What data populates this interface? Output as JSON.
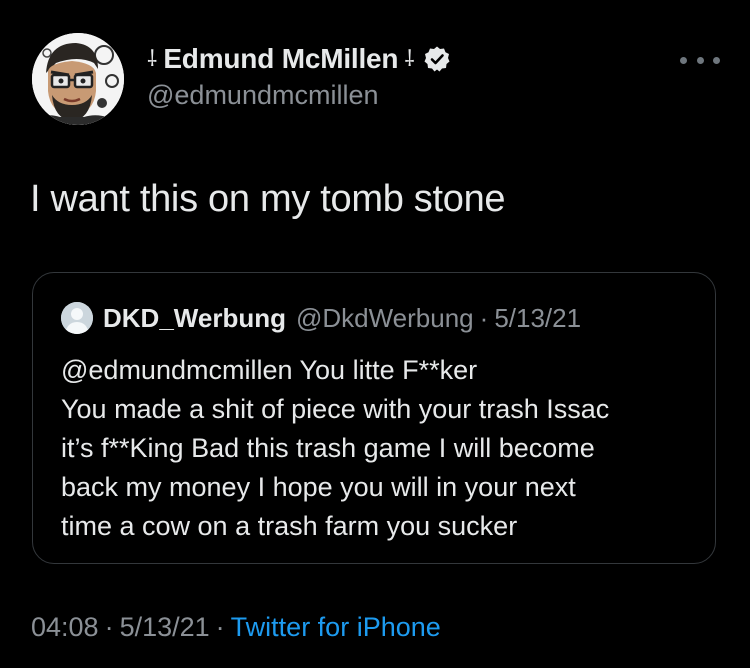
{
  "author": {
    "display_name": "Edmund McMillen",
    "handle": "@edmundmcmillen",
    "name_prefix_glyph": "⸸",
    "name_suffix_glyph": "⸸",
    "avatar_icon": "cartoon-portrait-avatar",
    "verified_icon": "verified-badge-icon"
  },
  "tweet": {
    "text": "I want this on my tomb stone"
  },
  "quoted_tweet": {
    "display_name": "DKD_Werbung",
    "handle": "@DkdWerbung",
    "separator": "·",
    "date": "5/13/21",
    "lines": [
      "@edmundmcmillen You litte F**ker",
      "You made a shit of piece with your trash Issac",
      "it’s f**King Bad this trash game I will become",
      "back my money I hope you will in your next",
      "time a cow on a trash farm you sucker"
    ]
  },
  "meta": {
    "time": "04:08",
    "separator": "·",
    "date": "5/13/21",
    "source": "Twitter for iPhone"
  },
  "colors": {
    "background": "#000000",
    "primary_text": "#e7e9ea",
    "secondary_text": "#8b9096",
    "link": "#1d9bf0",
    "border": "#33373b"
  }
}
